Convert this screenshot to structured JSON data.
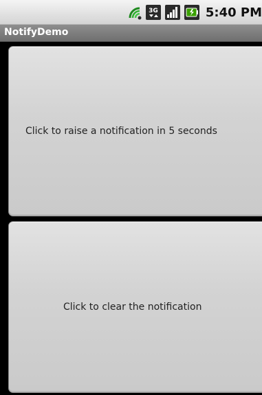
{
  "status_bar": {
    "time": "5:40 PM",
    "icons": [
      "sync-icon",
      "3g-icon",
      "signal-icon",
      "battery-icon"
    ]
  },
  "app": {
    "title": "NotifyDemo"
  },
  "buttons": {
    "raise_label": "Click to raise a notification in 5 seconds",
    "clear_label": "Click to clear the notification"
  },
  "colors": {
    "status_bar_bg": "#e0e0e0",
    "title_bar_bg": "#7d7d7d",
    "button_bg": "#d3d3d3",
    "battery_green": "#3aa000"
  }
}
